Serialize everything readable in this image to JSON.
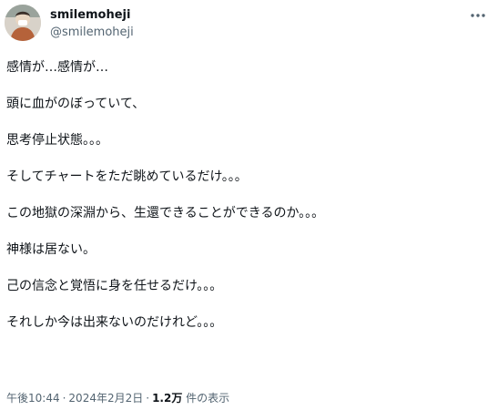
{
  "author": {
    "display_name": "smilemoheji",
    "handle": "@smilemoheji",
    "avatar_icon": "user-avatar-icon"
  },
  "menu": {
    "more_icon": "more-horizontal-icon"
  },
  "tweet": {
    "lines": [
      "感情が…感情が…",
      "頭に血がのぼっていて、",
      "思考停止状態。。。",
      "そしてチャートをただ眺めているだけ。。。",
      "この地獄の深淵から、生還できることができるのか。。。",
      "神様は居ない。",
      "己の信念と覚悟に身を任せるだけ。。。",
      "それしか今は出来ないのだけれど。。。"
    ]
  },
  "meta": {
    "time": "午後10:44",
    "separator": "·",
    "date": "2024年2月2日",
    "views_count": "1.2万",
    "views_label": "件の表示"
  },
  "colors": {
    "text_primary": "#0f1419",
    "text_secondary": "#536471",
    "background": "#ffffff"
  }
}
